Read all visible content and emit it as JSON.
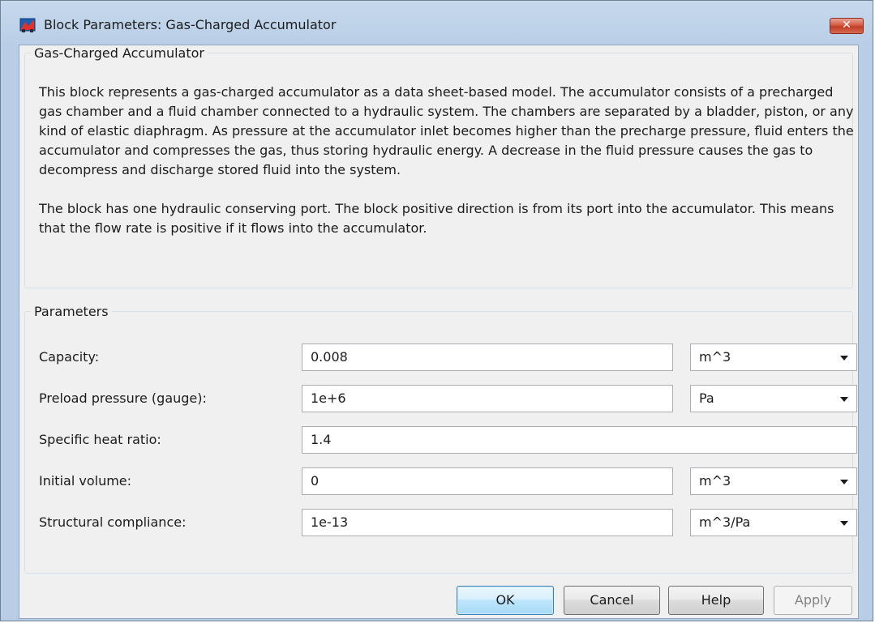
{
  "window": {
    "title": "Block Parameters: Gas-Charged Accumulator",
    "close_glyph": "✕",
    "icon": "simulink-block-icon"
  },
  "description": {
    "group_title": "Gas-Charged Accumulator",
    "paragraph1": "This block represents a gas-charged accumulator as a data sheet-based model. The accumulator consists of a precharged gas chamber and a fluid chamber connected to a hydraulic system. The chambers are separated by a bladder, piston, or any kind of elastic diaphragm. As pressure at the accumulator inlet becomes higher than the precharge pressure, fluid enters the accumulator and compresses the gas, thus storing hydraulic energy. A decrease in the fluid pressure causes the gas to decompress and discharge stored fluid into the system.",
    "paragraph2": "The block has one hydraulic conserving port. The block positive direction is from its port into the accumulator. This means that the flow rate is positive if it flows into the accumulator."
  },
  "parameters": {
    "group_title": "Parameters",
    "rows": [
      {
        "label": "Capacity:",
        "value": "0.008",
        "unit": "m^3"
      },
      {
        "label": "Preload pressure (gauge):",
        "value": "1e+6",
        "unit": "Pa"
      },
      {
        "label": "Specific heat ratio:",
        "value": "1.4"
      },
      {
        "label": "Initial volume:",
        "value": "0",
        "unit": "m^3"
      },
      {
        "label": "Structural compliance:",
        "value": "1e-13",
        "unit": "m^3/Pa"
      }
    ]
  },
  "buttons": {
    "ok": "OK",
    "cancel": "Cancel",
    "help": "Help",
    "apply": "Apply"
  },
  "colors": {
    "titlebar": "#bfd3ea",
    "dialog_background": "#f0f0f0",
    "close_button": "#c23d24",
    "default_button_border": "#3c7fb1"
  }
}
